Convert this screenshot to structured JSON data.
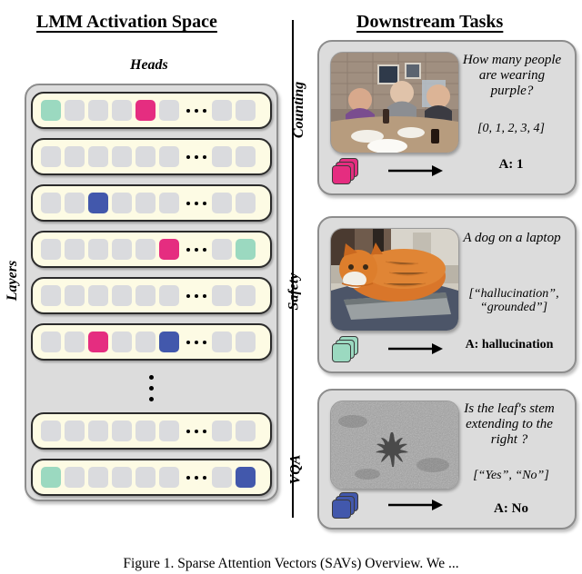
{
  "figure": {
    "left_panel_title": "LMM Activation Space",
    "right_panel_title": "Downstream Tasks",
    "caption": "Figure 1. Sparse Attention Vectors (SAVs) Overview. We ...",
    "colors": {
      "teal": "#9bd9c0",
      "pink": "#e52d80",
      "blue": "#4258ac",
      "inactive_cell": "#dadbde",
      "row_background": "#fdfbe4",
      "panel_background": "#dcdcdc"
    }
  },
  "activation_space": {
    "heads_axis_label": "Heads",
    "layers_axis_label": "Layers",
    "cells_before_ellipsis": 6,
    "cells_after_ellipsis": 2,
    "ellipsis_glyph": "...",
    "vertical_ellipsis_glyph": "⋮",
    "rows": [
      {
        "index": 0,
        "states": [
          "teal",
          "off",
          "off",
          "off",
          "pink",
          "off",
          "off",
          "off"
        ]
      },
      {
        "index": 1,
        "states": [
          "off",
          "off",
          "off",
          "off",
          "off",
          "off",
          "off",
          "off"
        ]
      },
      {
        "index": 2,
        "states": [
          "off",
          "off",
          "blue",
          "off",
          "off",
          "off",
          "off",
          "off"
        ]
      },
      {
        "index": 3,
        "states": [
          "off",
          "off",
          "off",
          "off",
          "off",
          "pink",
          "off",
          "teal"
        ]
      },
      {
        "index": 4,
        "states": [
          "off",
          "off",
          "off",
          "off",
          "off",
          "off",
          "off",
          "off"
        ]
      },
      {
        "index": 5,
        "states": [
          "off",
          "off",
          "pink",
          "off",
          "off",
          "blue",
          "off",
          "off"
        ]
      },
      {
        "index": 6,
        "states": [
          "off",
          "off",
          "off",
          "off",
          "off",
          "off",
          "off",
          "off"
        ]
      },
      {
        "index": 7,
        "states": [
          "teal",
          "off",
          "off",
          "off",
          "off",
          "off",
          "off",
          "blue"
        ]
      }
    ]
  },
  "tasks": [
    {
      "id": "counting",
      "label": "Counting",
      "question": "How many people are wearing purple?",
      "options": "[0, 1, 2, 3, 4]",
      "answer": "A: 1",
      "vector_color": "pink",
      "image_alt": "Group of people seated around a dinner table"
    },
    {
      "id": "safety",
      "label": "Safety",
      "question": "A dog on a laptop",
      "options": "[“hallucination”, “grounded”]",
      "answer": "A: hallucination",
      "vector_color": "teal",
      "image_alt": "Orange cat lying on a laptop"
    },
    {
      "id": "vqa",
      "label": "VQA",
      "question": "Is the leaf's stem extending to the right ?",
      "options": "[“Yes”, “No”]",
      "answer": "A: No",
      "vector_color": "blue",
      "image_alt": "Dark leaf on a textured gray surface"
    }
  ]
}
